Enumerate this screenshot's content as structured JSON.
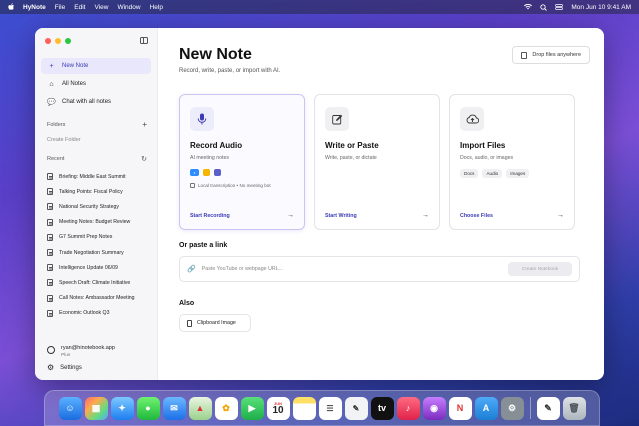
{
  "menubar": {
    "app": "HyNote",
    "items": [
      "File",
      "Edit",
      "View",
      "Window",
      "Help"
    ],
    "datetime": "Mon Jun 10  9:41 AM"
  },
  "sidebar": {
    "nav": [
      {
        "label": "New Note",
        "icon": "plus-icon"
      },
      {
        "label": "All Notes",
        "icon": "home-icon"
      },
      {
        "label": "Chat with all notes",
        "icon": "chat-icon"
      }
    ],
    "folders_label": "Folders",
    "create_folder": "Create Folder",
    "recent_label": "Recent",
    "recent": [
      "Briefing: Middle East Summit",
      "Talking Points: Fiscal Policy",
      "National Security Strategy",
      "Meeting Notes: Budget Review",
      "G7 Summit Prep Notes",
      "Trade Negotiation Summary",
      "Intelligence Update 06/09",
      "Speech Draft: Climate Initiative",
      "Call Notes: Ambassador Meeting",
      "Economic Outlook Q3"
    ],
    "account": {
      "email": "ryan@hinotebook.app",
      "plan": "Plus"
    },
    "settings": "Settings"
  },
  "main": {
    "title": "New Note",
    "subtitle": "Record, write, paste, or import with AI.",
    "drop_label": "Drop files anywhere",
    "cards": [
      {
        "title": "Record Audio",
        "desc": "AI meeting notes",
        "local": "Local transcription • No meeting bot",
        "action": "Start Recording"
      },
      {
        "title": "Write or Paste",
        "desc": "Write, paste, or dictate",
        "action": "Start Writing"
      },
      {
        "title": "Import Files",
        "desc": "Docs, audio, or images",
        "chips": [
          "Docs",
          "Audio",
          "Images"
        ],
        "action": "Choose Files"
      }
    ],
    "paste_label": "Or paste a link",
    "paste_placeholder": "Paste YouTube or webpage URL...",
    "create_button": "Create Notebook",
    "also_label": "Also",
    "clipboard_label": "Clipboard Image"
  },
  "dock": {
    "calendar_month": "JUN",
    "calendar_day": "10"
  }
}
